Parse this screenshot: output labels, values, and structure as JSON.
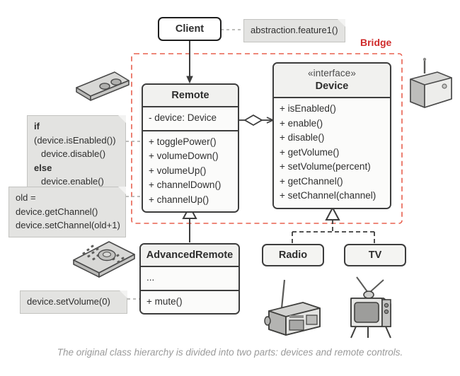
{
  "diagram": {
    "title_label": "Bridge",
    "caption": "The original class hierarchy is divided into two parts: devices and remote controls."
  },
  "client": {
    "name": "Client"
  },
  "notes": {
    "client_note": "abstraction.feature1()",
    "toggle_note": {
      "line1_kw": "if",
      "line1_rest": " (device.isEnabled())",
      "line2": "device.disable()",
      "line3_kw": "else",
      "line4": "device.enable()"
    },
    "channel_note": {
      "line1": "old = device.getChannel()",
      "line2": "device.setChannel(old+1)"
    },
    "mute_note": "device.setVolume(0)"
  },
  "remote": {
    "name": "Remote",
    "fields": [
      "- device: Device"
    ],
    "methods": [
      "+ togglePower()",
      "+ volumeDown()",
      "+ volumeUp()",
      "+ channelDown()",
      "+ channelUp()"
    ]
  },
  "device": {
    "stereotype": "«interface»",
    "name": "Device",
    "methods": [
      "+ isEnabled()",
      "+ enable()",
      "+ disable()",
      "+ getVolume()",
      "+ setVolume(percent)",
      "+ getChannel()",
      "+ setChannel(channel)"
    ]
  },
  "advanced_remote": {
    "name": "AdvancedRemote",
    "fields": [
      "..."
    ],
    "methods": [
      "+ mute()"
    ]
  },
  "radio": {
    "name": "Radio"
  },
  "tv": {
    "name": "TV"
  },
  "illustrations": {
    "simple_remote": "simple-remote-illustration",
    "advanced_remote": "advanced-remote-illustration",
    "generic_device": "generic-device-illustration",
    "radio": "radio-illustration",
    "tv": "tv-illustration"
  },
  "colors": {
    "bridge_accent": "#cf2b2b",
    "box_border": "#3d3d3d",
    "box_header_fill": "#f1f1ef",
    "box_body_fill": "#fbfbfa",
    "note_fill": "#e3e3e1",
    "caption_text": "#9a9a9a",
    "illustration_fill": "#d6d6d4"
  }
}
